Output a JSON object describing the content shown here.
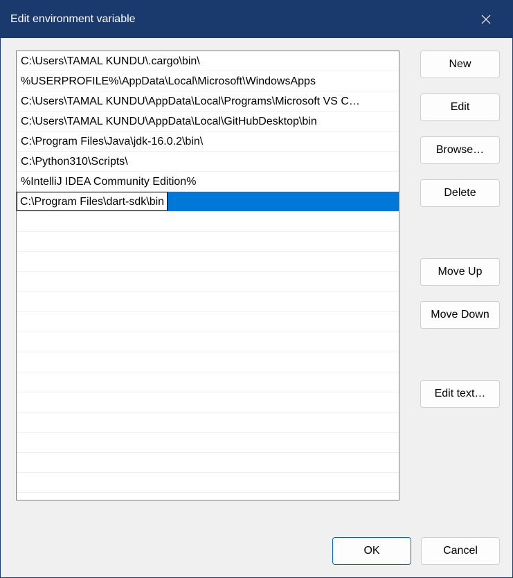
{
  "title": "Edit environment variable",
  "entries": [
    "C:\\Users\\TAMAL KUNDU\\.cargo\\bin\\",
    "%USERPROFILE%\\AppData\\Local\\Microsoft\\WindowsApps",
    "C:\\Users\\TAMAL KUNDU\\AppData\\Local\\Programs\\Microsoft VS C…",
    "C:\\Users\\TAMAL KUNDU\\AppData\\Local\\GitHubDesktop\\bin",
    "C:\\Program Files\\Java\\jdk-16.0.2\\bin\\",
    "C:\\Python310\\Scripts\\",
    "%IntelliJ IDEA Community Edition%",
    "C:\\Program Files\\dart-sdk\\bin"
  ],
  "selected_index": 7,
  "editing_index": 7,
  "blank_rows": 14,
  "buttons": {
    "new": "New",
    "edit": "Edit",
    "browse": "Browse…",
    "delete": "Delete",
    "move_up": "Move Up",
    "move_down": "Move Down",
    "edit_text": "Edit text…",
    "ok": "OK",
    "cancel": "Cancel"
  }
}
